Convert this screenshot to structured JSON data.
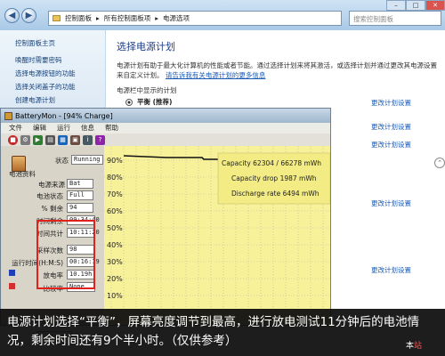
{
  "control_panel": {
    "breadcrumb": [
      "控制面板",
      "所有控制面板项",
      "电源选项"
    ],
    "search_placeholder": "搜索控制面板",
    "sidebar_links": [
      "控制面板主页",
      "唤醒时需要密码",
      "选择电源按钮的功能",
      "选择关闭盖子的功能",
      "创建电源计划"
    ],
    "main_title": "选择电源计划",
    "description": "电源计划有助于最大化计算机的性能或者节能。通过选择计划来将其激活，或选择计划并通过更改其电源设置来自定义计划。",
    "description_link": "请告诉我有关电源计划的更多信息",
    "plans_heading": "电源栏中显示的计划",
    "selected_plan": "平衡 (推荐)",
    "config_link": "更改计划设置"
  },
  "batterymon": {
    "window_title": "BatteryMon - [94% Charge]",
    "menu": [
      "文件",
      "编辑",
      "运行",
      "信息",
      "帮助"
    ],
    "status_label": "状态",
    "status_value": "Running",
    "battery_info_label": "电池资料",
    "power_source_label": "电源来源",
    "power_source_value": "Bat",
    "battery_status_label": "电池状态",
    "battery_status_value": "Full",
    "percent_label": "% 剩余",
    "percent_value": "94",
    "time_left_label": "时间剩余",
    "time_left_value": "09:34:40",
    "time_total_label": "时间共计",
    "time_total_value": "10:11:20",
    "sample_count_label": "采样次数",
    "sample_count_value": "98",
    "run_time_label": "运行时间(H:M:S)",
    "run_time_value": "00:16:19",
    "discharge_label": "放电率",
    "discharge_value": "10.19h",
    "compare_label": "比较率",
    "compare_value": "None",
    "start_button": "开始",
    "chart_y_ticks": [
      "90%",
      "80%",
      "70%",
      "60%",
      "50%",
      "40%",
      "30%",
      "20%",
      "10%"
    ],
    "chart_info": [
      "Capacity 62304 / 66278 mWh",
      "Capacity drop 1987 mWh",
      "Discharge rate 6494 mWh"
    ]
  },
  "caption": "电源计划选择“平衡”，屏幕亮度调节到最高，进行放电测试11分钟后的电池情况，剩余时间还有9个半小时。（仅供参考）",
  "watermark": {
    "main": "本",
    "accent": "站"
  }
}
